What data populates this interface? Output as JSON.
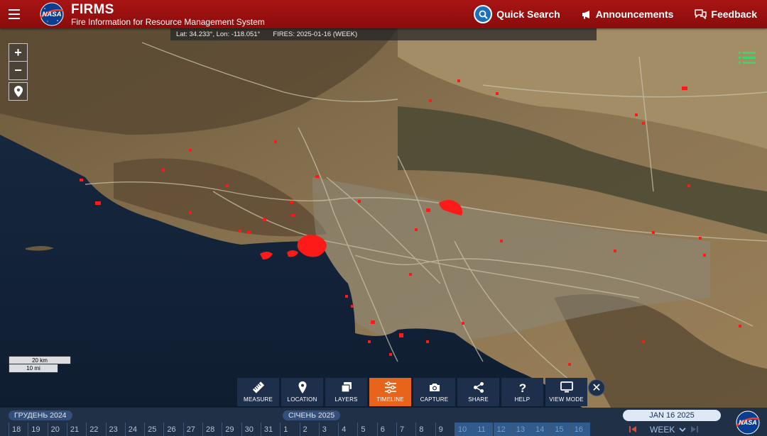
{
  "app": {
    "title": "FIRMS",
    "subtitle": "Fire Information for Resource Management System",
    "logo_text": "NASA"
  },
  "header": {
    "quick_search": "Quick Search",
    "announcements": "Announcements",
    "feedback": "Feedback"
  },
  "infobar": {
    "coords": "Lat: 34.233°, Lon: -118.051°",
    "fires": "FIRES: 2025-01-16 (WEEK)"
  },
  "map_controls": {
    "zoom_in": "+",
    "zoom_out": "−"
  },
  "scale": {
    "km": "20 km",
    "mi": "10 mi"
  },
  "toolbar": [
    {
      "label": "MEASURE",
      "icon": "ruler-icon"
    },
    {
      "label": "LOCATION",
      "icon": "map-pin-icon"
    },
    {
      "label": "LAYERS",
      "icon": "layers-icon"
    },
    {
      "label": "TIMELINE",
      "icon": "sliders-icon",
      "active": true
    },
    {
      "label": "CAPTURE",
      "icon": "camera-icon"
    },
    {
      "label": "SHARE",
      "icon": "share-icon"
    },
    {
      "label": "HELP",
      "icon": "question-icon"
    },
    {
      "label": "VIEW MODE",
      "icon": "monitor-icon"
    }
  ],
  "timeline": {
    "months": [
      "ГРУДЕНЬ 2024",
      "СІЧЕНЬ 2025"
    ],
    "days": [
      "18",
      "19",
      "20",
      "21",
      "22",
      "23",
      "24",
      "25",
      "26",
      "27",
      "28",
      "29",
      "30",
      "31",
      "1",
      "2",
      "3",
      "4",
      "5",
      "6",
      "7",
      "8",
      "9",
      "10",
      "11",
      "12",
      "13",
      "14",
      "15",
      "16"
    ],
    "selected_days": [
      "10",
      "11",
      "12",
      "13",
      "14",
      "15",
      "16"
    ],
    "current_date": "JAN 16 2025",
    "period": "WEEK"
  },
  "colors": {
    "header_red": "#9e1010",
    "fire_red": "#ff1a1a",
    "active_tool": "#e8641b",
    "toolbar_bg": "#1d2f4a"
  }
}
